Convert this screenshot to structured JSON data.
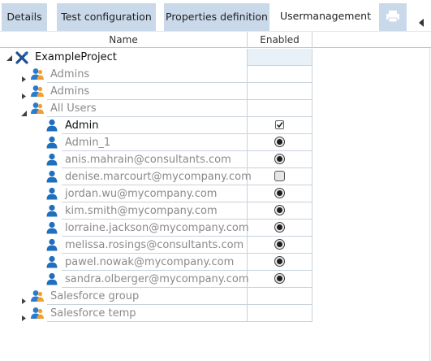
{
  "tabs": [
    {
      "label": "Details"
    },
    {
      "label": "Test configuration"
    },
    {
      "label": "Properties definition"
    },
    {
      "label": "Usermanagement"
    }
  ],
  "icons": {
    "print": "printer-icon",
    "scroll": "chevron-left-icon"
  },
  "columns": {
    "name": "Name",
    "enabled": "Enabled"
  },
  "project": {
    "name": "ExampleProject"
  },
  "tree": {
    "groups_top": [
      {
        "label": "Admins"
      },
      {
        "label": "Admins"
      },
      {
        "label": "All Users"
      }
    ],
    "users": [
      {
        "label": "Admin",
        "state": "checked"
      },
      {
        "label": "Admin_1",
        "state": "on"
      },
      {
        "label": "anis.mahrain@consultants.com",
        "state": "on"
      },
      {
        "label": "denise.marcourt@mycompany.com",
        "state": "off"
      },
      {
        "label": "jordan.wu@mycompany.com",
        "state": "on"
      },
      {
        "label": "kim.smith@mycompany.com",
        "state": "on"
      },
      {
        "label": "lorraine.jackson@mycompany.com",
        "state": "on"
      },
      {
        "label": "melissa.rosings@consultants.com",
        "state": "on"
      },
      {
        "label": "pawel.nowak@mycompany.com",
        "state": "on"
      },
      {
        "label": "sandra.olberger@mycompany.com",
        "state": "on"
      }
    ],
    "groups_bottom": [
      {
        "label": "Salesforce group"
      },
      {
        "label": "Salesforce temp"
      }
    ]
  },
  "colors": {
    "tab_bg": "#c9d9ea",
    "user_icon": "#1e6fbf",
    "grid_line": "#c9d2dc"
  }
}
